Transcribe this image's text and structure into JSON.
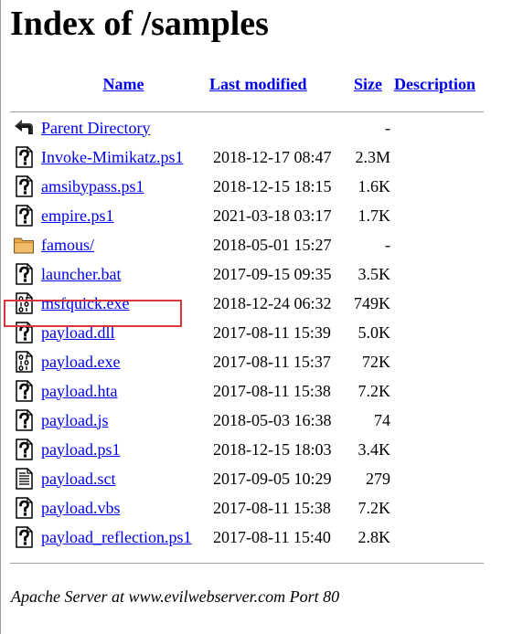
{
  "page": {
    "title": "Index of /samples",
    "footer": "Apache Server at www.evilwebserver.com Port 80"
  },
  "columns": {
    "name": "Name",
    "last_modified": "Last modified",
    "size": "Size",
    "description": "Description"
  },
  "parent": {
    "label": "Parent Directory",
    "size": "-",
    "icon": "back-arrow-icon"
  },
  "files": [
    {
      "name": "Invoke-Mimikatz.ps1",
      "modified": "2018-12-17 08:47",
      "size": "2.3M",
      "icon": "unknown-file-icon"
    },
    {
      "name": "amsibypass.ps1",
      "modified": "2018-12-15 18:15",
      "size": "1.6K",
      "icon": "unknown-file-icon"
    },
    {
      "name": "empire.ps1",
      "modified": "2021-03-18 03:17",
      "size": "1.7K",
      "icon": "unknown-file-icon"
    },
    {
      "name": "famous/",
      "modified": "2018-05-01 15:27",
      "size": "-",
      "icon": "folder-icon"
    },
    {
      "name": "launcher.bat",
      "modified": "2017-09-15 09:35",
      "size": "3.5K",
      "icon": "unknown-file-icon"
    },
    {
      "name": "msfquick.exe",
      "modified": "2018-12-24 06:32",
      "size": "749K",
      "icon": "binary-file-icon",
      "highlighted": true
    },
    {
      "name": "payload.dll",
      "modified": "2017-08-11 15:39",
      "size": "5.0K",
      "icon": "unknown-file-icon"
    },
    {
      "name": "payload.exe",
      "modified": "2017-08-11 15:37",
      "size": "72K",
      "icon": "binary-file-icon"
    },
    {
      "name": "payload.hta",
      "modified": "2017-08-11 15:38",
      "size": "7.2K",
      "icon": "unknown-file-icon"
    },
    {
      "name": "payload.js",
      "modified": "2018-05-03 16:38",
      "size": "74",
      "icon": "unknown-file-icon"
    },
    {
      "name": "payload.ps1",
      "modified": "2018-12-15 18:03",
      "size": "3.4K",
      "icon": "unknown-file-icon"
    },
    {
      "name": "payload.sct",
      "modified": "2017-09-05 10:29",
      "size": "279",
      "icon": "text-file-icon"
    },
    {
      "name": "payload.vbs",
      "modified": "2017-08-11 15:38",
      "size": "7.2K",
      "icon": "unknown-file-icon"
    },
    {
      "name": "payload_reflection.ps1",
      "modified": "2017-08-11 15:40",
      "size": "2.8K",
      "icon": "unknown-file-icon"
    }
  ],
  "colors": {
    "link": "#0000ee",
    "highlight_border": "#d9363e",
    "folder": "#e8a84c"
  }
}
